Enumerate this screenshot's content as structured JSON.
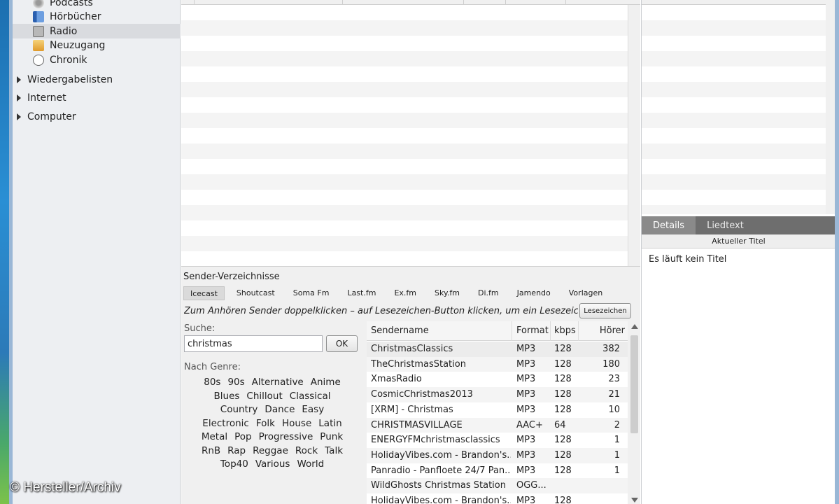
{
  "sidebar": {
    "items": [
      {
        "label": "Podcasts",
        "icon": "podcast-icon"
      },
      {
        "label": "Hörbücher",
        "icon": "audiobook-icon"
      },
      {
        "label": "Radio",
        "icon": "radio-icon"
      },
      {
        "label": "Neuzugang",
        "icon": "new-music-icon"
      },
      {
        "label": "Chronik",
        "icon": "clock-icon"
      }
    ],
    "groups": [
      {
        "label": "Wiedergabelisten"
      },
      {
        "label": "Internet"
      },
      {
        "label": "Computer"
      }
    ]
  },
  "right": {
    "tabs": [
      "Details",
      "Liedtext"
    ],
    "current_title_header": "Aktueller Titel",
    "current_title_value": "Es läuft kein Titel"
  },
  "radio": {
    "title": "Sender-Verzeichnisse",
    "tabs": [
      "Icecast",
      "Shoutcast",
      "Soma Fm",
      "Last.fm",
      "Ex.fm",
      "Sky.fm",
      "Di.fm",
      "Jamendo",
      "Vorlagen"
    ],
    "hint": "Zum Anhören Sender doppelklicken – auf Lesezeichen-Button klicken, um ein Lesezeichen zu s",
    "bookmark_button": "Lesezeichen",
    "search_label": "Suche:",
    "search_value": "christmas",
    "ok_button": "OK",
    "genre_label": "Nach Genre:",
    "genre_rows": [
      [
        "80s",
        "90s",
        "Alternative",
        "Anime"
      ],
      [
        "Blues",
        "Chillout",
        "Classical"
      ],
      [
        "Country",
        "Dance",
        "Easy"
      ],
      [
        "Electronic",
        "Folk",
        "House",
        "Latin"
      ],
      [
        "Metal",
        "Pop",
        "Progressive",
        "Punk"
      ],
      [
        "RnB",
        "Rap",
        "Reggae",
        "Rock",
        "Talk"
      ],
      [
        "Top40",
        "Various",
        "World"
      ]
    ],
    "columns": {
      "name": "Sendername",
      "format": "Format",
      "kbps": "kbps",
      "listeners": "Hörer"
    },
    "stations": [
      {
        "name": "ChristmasClassics",
        "format": "MP3",
        "kbps": "128",
        "listeners": "382"
      },
      {
        "name": "TheChristmasStation",
        "format": "MP3",
        "kbps": "128",
        "listeners": "180"
      },
      {
        "name": "XmasRadio",
        "format": "MP3",
        "kbps": "128",
        "listeners": "23"
      },
      {
        "name": "CosmicChristmas2013",
        "format": "MP3",
        "kbps": "128",
        "listeners": "21"
      },
      {
        "name": "[XRM] - Christmas",
        "format": "MP3",
        "kbps": "128",
        "listeners": "10"
      },
      {
        "name": "CHRISTMASVILLAGE",
        "format": "AAC+",
        "kbps": "64",
        "listeners": "2"
      },
      {
        "name": "ENERGYFMchristmasclassics",
        "format": "MP3",
        "kbps": "128",
        "listeners": "1"
      },
      {
        "name": "HolidayVibes.com - Brandon's...",
        "format": "MP3",
        "kbps": "128",
        "listeners": "1"
      },
      {
        "name": "Panradio - Panfloete 24/7 Pan...",
        "format": "MP3",
        "kbps": "128",
        "listeners": "1"
      },
      {
        "name": "WildGhosts Christmas Station",
        "format": "OGG...",
        "kbps": "",
        "listeners": ""
      },
      {
        "name": "HolidayVibes.com - Brandon's...",
        "format": "MP3",
        "kbps": "128",
        "listeners": ""
      }
    ]
  },
  "watermark": "© Hersteller/Archiv",
  "colors": {
    "sidebar_bg": "#edeff2",
    "tab_bar": "#6e6e6e",
    "selected_row": "#d9dbdf"
  }
}
